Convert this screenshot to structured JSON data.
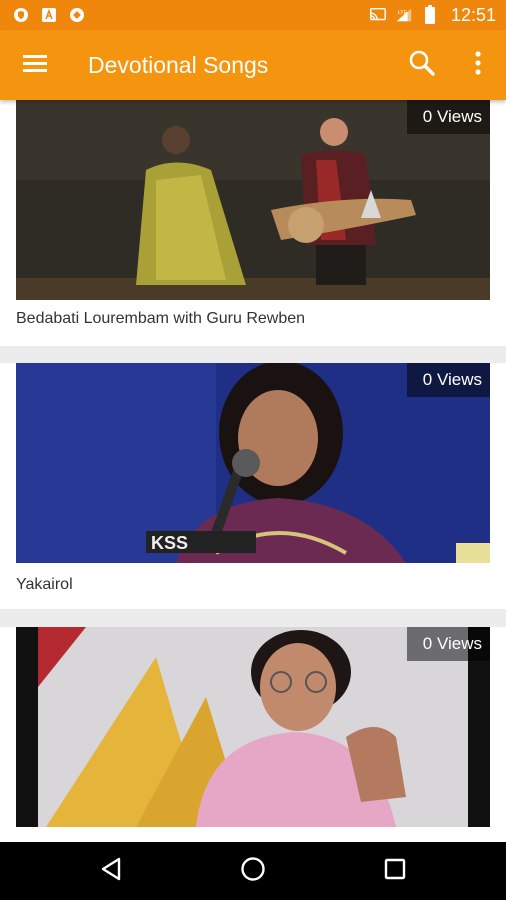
{
  "status_bar": {
    "time": "12:51",
    "icons": [
      "shield-icon",
      "a-icon",
      "no-entry-icon",
      "cast-icon",
      "signal-lte-icon",
      "battery-icon"
    ]
  },
  "app_bar": {
    "title": "Devotional Songs",
    "icons": [
      "hamburger-menu-icon",
      "search-icon",
      "more-vert-icon"
    ],
    "color": "#f5940f"
  },
  "videos": [
    {
      "title": "Bedabati Lourembam with Guru Rewben",
      "views": "0 Views"
    },
    {
      "title": "Yakairol",
      "views": "0 Views"
    },
    {
      "title": "",
      "views": "0 Views"
    }
  ],
  "nav_bar": {
    "icons": [
      "back-icon",
      "home-icon",
      "recents-icon"
    ]
  }
}
